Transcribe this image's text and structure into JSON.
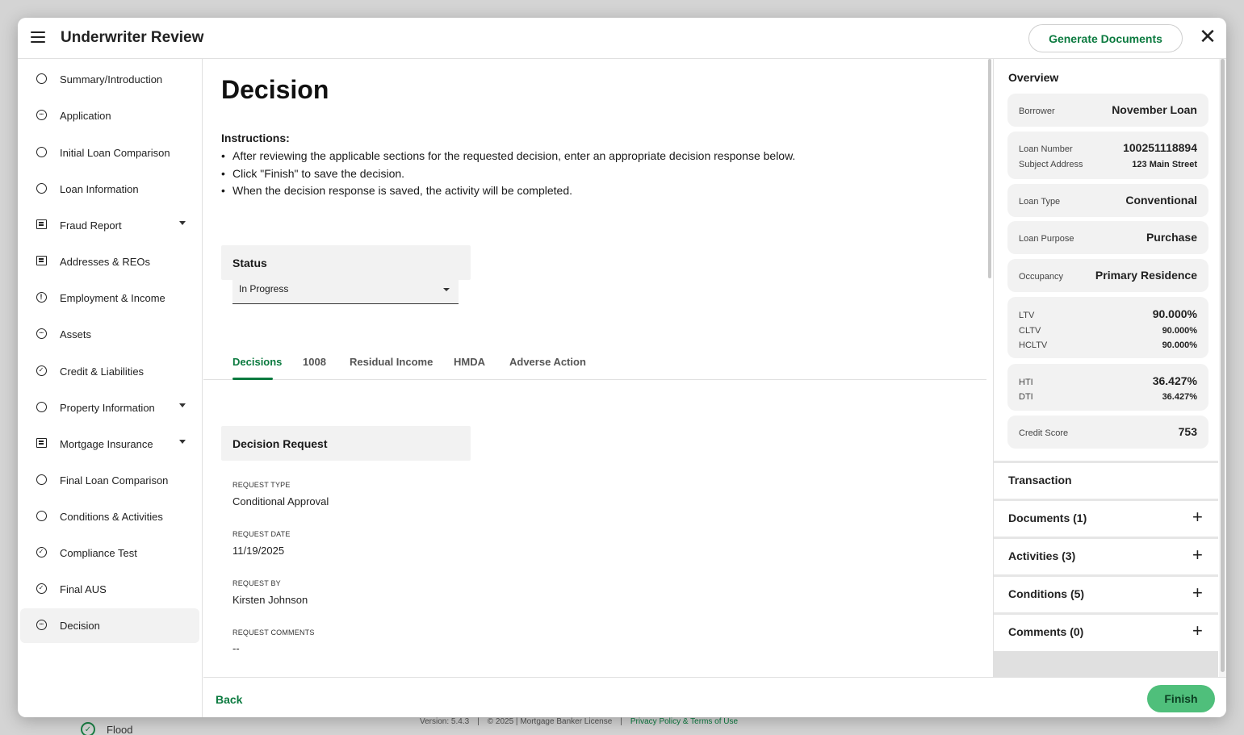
{
  "modal": {
    "title": "Underwriter Review",
    "generate_documents_label": "Generate Documents",
    "close_label": "✕"
  },
  "sidebar": {
    "items": [
      {
        "label": "Summary/Introduction",
        "icon": "circle-icon"
      },
      {
        "label": "Application",
        "icon": "dots-circle-icon"
      },
      {
        "label": "Initial Loan Comparison",
        "icon": "circle-icon"
      },
      {
        "label": "Loan Information",
        "icon": "circle-icon"
      },
      {
        "label": "Fraud Report",
        "icon": "report-icon",
        "expandable": true
      },
      {
        "label": "Addresses & REOs",
        "icon": "report-icon"
      },
      {
        "label": "Employment & Income",
        "icon": "alert-circle-icon"
      },
      {
        "label": "Assets",
        "icon": "dots-circle-icon"
      },
      {
        "label": "Credit & Liabilities",
        "icon": "check-circle-icon"
      },
      {
        "label": "Property Information",
        "icon": "circle-icon",
        "expandable": true
      },
      {
        "label": "Mortgage Insurance",
        "icon": "report-icon",
        "expandable": true
      },
      {
        "label": "Final Loan Comparison",
        "icon": "circle-icon"
      },
      {
        "label": "Conditions & Activities",
        "icon": "circle-icon"
      },
      {
        "label": "Compliance Test",
        "icon": "check-circle-icon"
      },
      {
        "label": "Final AUS",
        "icon": "check-circle-icon"
      },
      {
        "label": "Decision",
        "icon": "dots-circle-icon",
        "active": true
      }
    ]
  },
  "main": {
    "title": "Decision",
    "instructions_heading": "Instructions:",
    "instructions": [
      "After reviewing the applicable sections for the requested decision, enter an appropriate decision response below.",
      "Click \"Finish\" to save the decision.",
      "When the decision response is saved, the activity will be completed."
    ],
    "status_heading": "Status",
    "status_value": "In Progress",
    "tabs": [
      "Decisions",
      "1008",
      "Residual Income",
      "HMDA",
      "Adverse Action"
    ],
    "decision_request_heading": "Decision Request",
    "fields": [
      {
        "label": "REQUEST TYPE",
        "value": "Conditional Approval"
      },
      {
        "label": "REQUEST DATE",
        "value": "11/19/2025"
      },
      {
        "label": "REQUEST BY",
        "value": "Kirsten Johnson"
      },
      {
        "label": "REQUEST COMMENTS",
        "value": "--"
      }
    ]
  },
  "footer": {
    "back_label": "Back",
    "finish_label": "Finish"
  },
  "overview": {
    "heading": "Overview",
    "borrower_label": "Borrower",
    "borrower_value": "November Loan",
    "loan_number_label": "Loan Number",
    "loan_number_value": "100251118894",
    "subject_address_label": "Subject Address",
    "subject_address_value": "123 Main Street",
    "loan_type_label": "Loan Type",
    "loan_type_value": "Conventional",
    "loan_purpose_label": "Loan Purpose",
    "loan_purpose_value": "Purchase",
    "occupancy_label": "Occupancy",
    "occupancy_value": "Primary Residence",
    "ltv_label": "LTV",
    "ltv_value": "90.000%",
    "cltv_label": "CLTV",
    "cltv_value": "90.000%",
    "hcltv_label": "HCLTV",
    "hcltv_value": "90.000%",
    "hti_label": "HTI",
    "hti_value": "36.427%",
    "dti_label": "DTI",
    "dti_value": "36.427%",
    "credit_score_label": "Credit Score",
    "credit_score_value": "753"
  },
  "accordions": {
    "transaction": "Transaction",
    "documents": "Documents (1)",
    "activities": "Activities (3)",
    "conditions": "Conditions (5)",
    "comments": "Comments (0)"
  },
  "background": {
    "footer_version": "Version: 5.4.3",
    "footer_copyright": "© 2025 | Mortgage Banker License",
    "footer_link": "Privacy Policy & Terms of Use",
    "sidebar_item": "Flood"
  },
  "colors": {
    "accent": "#0b7a3f",
    "finish_button": "#4fbf7b",
    "panel_gray": "#f2f2f2"
  }
}
